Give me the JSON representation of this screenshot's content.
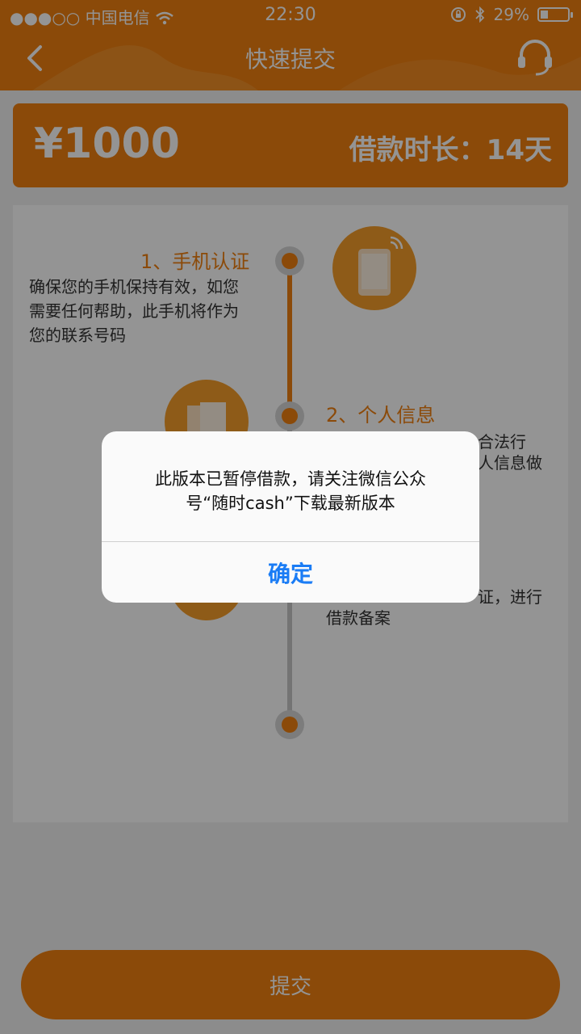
{
  "status_bar": {
    "signal": "●●●○○",
    "carrier": "中国电信",
    "time": "22:30",
    "battery_percent": "29%",
    "battery_level": 0.29
  },
  "nav": {
    "title": "快速提交"
  },
  "amount_card": {
    "amount": "¥1000",
    "duration": "借款时长：14天"
  },
  "steps": [
    {
      "title": "1、手机认证",
      "desc": "确保您的手机保持有效，如您需要任何帮助，此手机将作为您的联系号码"
    },
    {
      "title": "2、个人信息",
      "desc_line1": "合法行",
      "desc_line2": "人信息做"
    },
    {
      "desc_line1": "证，进行",
      "desc_line2": "借款备案"
    }
  ],
  "submit": {
    "label": "提交"
  },
  "dialog": {
    "message_line1": "此版本已暂停借款，请关注微信公众",
    "message_line2": "号“随时cash”下载最新版本",
    "confirm_label": "确定"
  },
  "colors": {
    "accent": "#f08010",
    "link": "#1a7cf5"
  }
}
